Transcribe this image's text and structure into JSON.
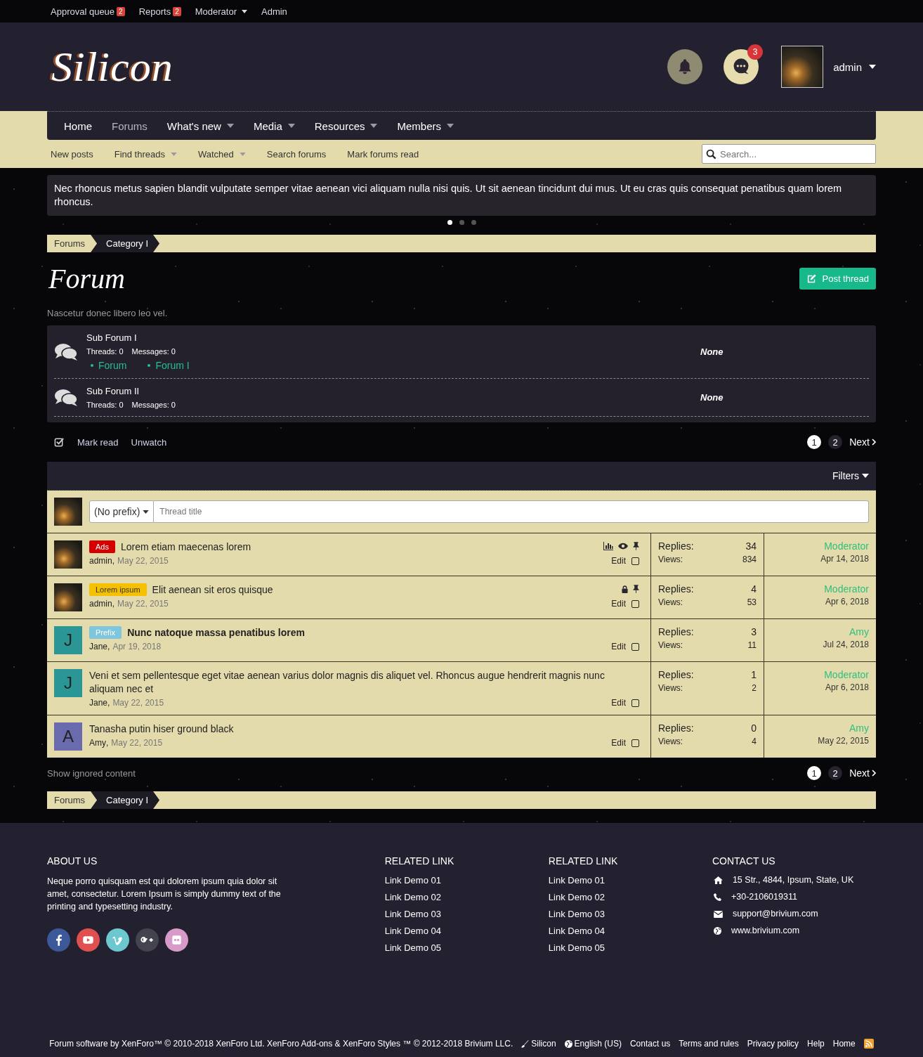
{
  "staff_bar": [
    {
      "label": "Approval queue",
      "count": "2",
      "dropdown": false
    },
    {
      "label": "Reports",
      "count": "2",
      "dropdown": false
    },
    {
      "label": "Moderator",
      "dropdown": true
    },
    {
      "label": "Admin",
      "dropdown": false
    }
  ],
  "header": {
    "logo": "Silicon",
    "conversations_count": "3",
    "user": "admin"
  },
  "nav": [
    {
      "label": "Home",
      "selected": false,
      "dropdown": false
    },
    {
      "label": "Forums",
      "selected": true,
      "dropdown": false
    },
    {
      "label": "What's new",
      "selected": false,
      "dropdown": true
    },
    {
      "label": "Media",
      "selected": false,
      "dropdown": true
    },
    {
      "label": "Resources",
      "selected": false,
      "dropdown": true
    },
    {
      "label": "Members",
      "selected": false,
      "dropdown": true
    }
  ],
  "subnav": [
    {
      "label": "New posts",
      "dropdown": false
    },
    {
      "label": "Find threads",
      "dropdown": true
    },
    {
      "label": "Watched",
      "dropdown": true
    },
    {
      "label": "Search forums",
      "dropdown": false
    },
    {
      "label": "Mark forums read",
      "dropdown": false
    }
  ],
  "search": {
    "placeholder": "Search..."
  },
  "notice": {
    "text": "Nec rhoncus metus sapien blandit vulputate semper vitae aenean vici aliquam nulla nisi quis. Ut sit aenean tincidunt dui mus. Ut eu cras quis consequat penatibus quam lorem rhoncus.",
    "dots": [
      {
        "selected": true
      },
      {
        "selected": false
      },
      {
        "selected": false
      }
    ]
  },
  "breadcrumb": [
    "Forums",
    "Category I"
  ],
  "page": {
    "title": "Forum",
    "description": "Nascetur donec libero leo vel.",
    "post_button": "Post thread"
  },
  "subforums": [
    {
      "title": "Sub Forum I",
      "threads": "Threads: 0",
      "messages": "Messages: 0",
      "links": [
        "Forum",
        "Forum I"
      ],
      "latest": "None"
    },
    {
      "title": "Sub Forum II",
      "threads": "Threads: 0",
      "messages": "Messages: 0",
      "latest": "None"
    }
  ],
  "actions": {
    "mark_read": "Mark read",
    "unwatch": "Unwatch"
  },
  "pagination": {
    "pages": [
      {
        "label": "1",
        "selected": true
      },
      {
        "label": "2",
        "selected": false
      }
    ],
    "next": "Next"
  },
  "threads": {
    "filters": "Filters",
    "quick_thread": {
      "prefix": "(No prefix)",
      "placeholder": "Thread title"
    },
    "rows": [
      {
        "avatar": {
          "kind": "photo"
        },
        "prefix": {
          "label": "Ads",
          "color": "#d40000"
        },
        "title": "Lorem etiam maecenas lorem",
        "unread": false,
        "author": "admin",
        "separator": ",",
        "date": "May 22, 2015",
        "poll": true,
        "watched": true,
        "locked": false,
        "sticky": true,
        "edit": "Edit",
        "checked": false,
        "replies_label": "Replies:",
        "replies": "34",
        "views_label": "Views:",
        "views": "834",
        "last_user": "Moderator",
        "last_date": "Apr 14, 2018"
      },
      {
        "avatar": {
          "kind": "photo"
        },
        "prefix": {
          "label": "Lorem ipsum",
          "color": "#f5c000"
        },
        "title": "Elit aenean sit eros quisque",
        "unread": false,
        "author": "admin",
        "separator": ",",
        "date": "May 22, 2015",
        "poll": false,
        "watched": false,
        "locked": true,
        "sticky": true,
        "edit": "Edit",
        "checked": false,
        "replies_label": "Replies:",
        "replies": "4",
        "views_label": "Views:",
        "views": "53",
        "last_user": "Moderator",
        "last_date": "Apr 6, 2018"
      },
      {
        "avatar": {
          "kind": "letter",
          "letter": "J",
          "color": "#2a9696"
        },
        "prefix": {
          "label": "Prefix",
          "color": "#7ec5de"
        },
        "title": "Nunc natoque massa penatibus lorem",
        "unread": true,
        "author": "Jane",
        "separator": ",",
        "date": "Apr 19, 2018",
        "poll": false,
        "watched": false,
        "locked": false,
        "sticky": false,
        "edit": "Edit",
        "checked": false,
        "replies_label": "Replies:",
        "replies": "3",
        "views_label": "Views:",
        "views": "11",
        "last_user": "Amy",
        "last_date": "Jul 24, 2018"
      },
      {
        "avatar": {
          "kind": "letter",
          "letter": "J",
          "color": "#2a9696"
        },
        "title": "Veni et sem pellentesque eget vitae aenean varius dolor magnis dis aliquet vel. Rhoncus augue hendrerit magnis nunc aliquam nec et",
        "unread": false,
        "author": "Jane",
        "separator": ",",
        "date": "May 22, 2015",
        "poll": false,
        "watched": false,
        "locked": false,
        "sticky": false,
        "edit": "Edit",
        "checked": false,
        "replies_label": "Replies:",
        "replies": "1",
        "views_label": "Views:",
        "views": "2",
        "last_user": "Moderator",
        "last_date": "Apr 6, 2018"
      },
      {
        "avatar": {
          "kind": "letter",
          "letter": "A",
          "color": "#6a6aae"
        },
        "title": "Tanasha putin hiser ground black",
        "unread": false,
        "author": "Amy",
        "separator": ",",
        "date": "May 22, 2015",
        "poll": false,
        "watched": false,
        "locked": false,
        "sticky": false,
        "edit": "Edit",
        "checked": false,
        "replies_label": "Replies:",
        "replies": "0",
        "views_label": "Views:",
        "views": "4",
        "last_user": "Amy",
        "last_date": "May 22, 2015"
      }
    ]
  },
  "ignored": "Show ignored content",
  "pagination_bottom": {
    "pages": [
      {
        "label": "1",
        "selected": true
      },
      {
        "label": "2",
        "selected": false
      }
    ],
    "next": "Next"
  },
  "breadcrumb_bottom": [
    "Forums",
    "Category I"
  ],
  "footer": {
    "about": {
      "title": "ABOUT US",
      "text": "Neque porro quisquam est qui dolorem ipsum quia dolor sit amet, consectetur. Lorem Ipsum is simply dummy text of the printing and typesetting industry."
    },
    "social": [
      {
        "kind": "facebook",
        "color": "#3b5998"
      },
      {
        "kind": "youtube",
        "color": "#e05050"
      },
      {
        "kind": "vimeo",
        "color": "#6cc7cf"
      },
      {
        "kind": "gplus",
        "color": "#444450"
      },
      {
        "kind": "flickr",
        "color": "#d89ac8"
      }
    ],
    "link_columns": [
      {
        "title": "RELATED LINK",
        "links": [
          "Link Demo 01",
          "Link Demo 02",
          "Link Demo 03",
          "Link Demo 04",
          "Link Demo 05"
        ]
      },
      {
        "title": "RELATED LINK",
        "links": [
          "Link Demo 01",
          "Link Demo 02",
          "Link Demo 03",
          "Link Demo 04",
          "Link Demo 05"
        ]
      }
    ],
    "contact": {
      "title": "CONTACT US",
      "items": [
        {
          "kind": "address",
          "text": "15 Str., 4844, Ipsum, State, UK"
        },
        {
          "kind": "phone",
          "text": "+30-2106019311"
        },
        {
          "kind": "email",
          "text": "support@brivium.com"
        },
        {
          "kind": "web",
          "text": "www.brivium.com"
        }
      ]
    },
    "copyright": "Forum software by XenForo™ © 2010-2018 XenForo Ltd. XenForo Add-ons & XenForo Styles ™ © 2012-2018 Brivium LLC.",
    "style": "Silicon",
    "language": "English (US)",
    "links": [
      "Contact us",
      "Terms and rules",
      "Privacy policy",
      "Help",
      "Home"
    ]
  }
}
